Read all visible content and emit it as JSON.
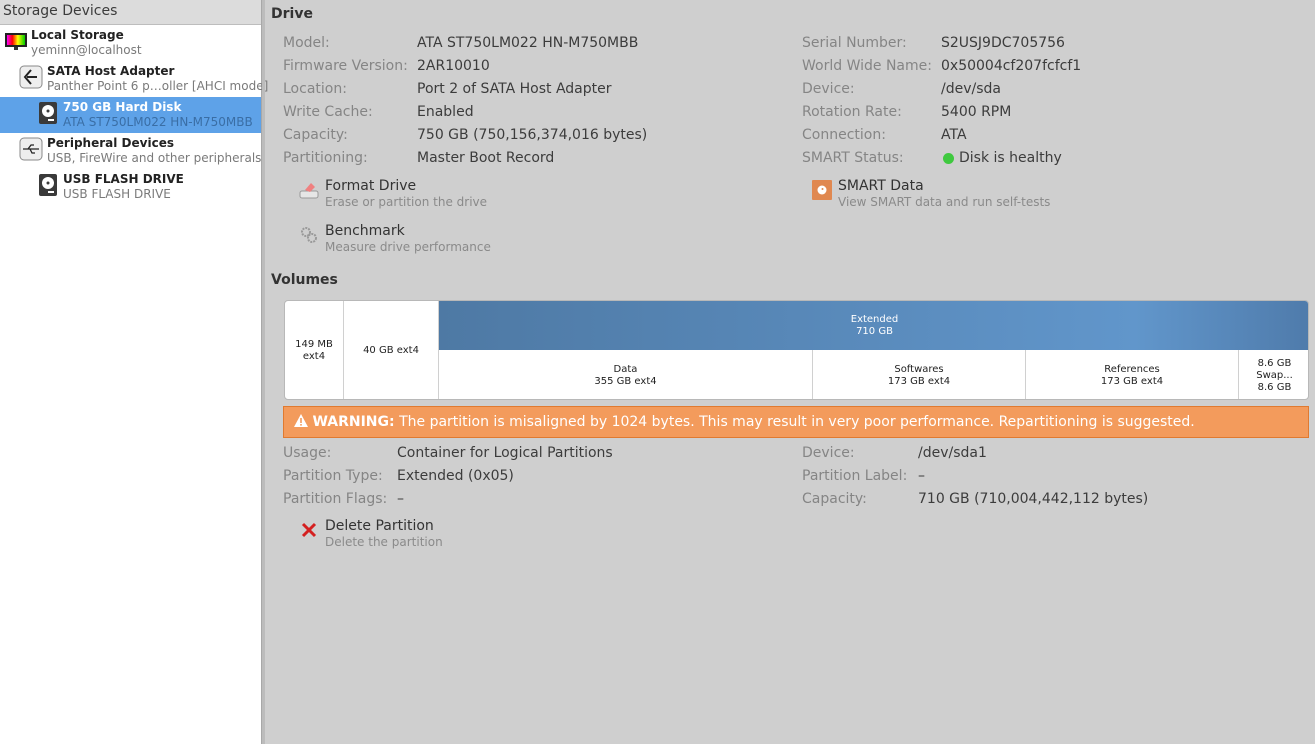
{
  "sidebar": {
    "title": "Storage Devices",
    "items": [
      {
        "title": "Local Storage",
        "subtitle": "yeminn@localhost"
      },
      {
        "title": "SATA Host Adapter",
        "subtitle": "Panther Point 6 p…oller [AHCI mode]"
      },
      {
        "title": "750 GB Hard Disk",
        "subtitle": "ATA ST750LM022 HN-M750MBB"
      },
      {
        "title": "Peripheral Devices",
        "subtitle": "USB, FireWire and other peripherals"
      },
      {
        "title": "USB FLASH DRIVE",
        "subtitle": "USB FLASH DRIVE"
      }
    ]
  },
  "drive": {
    "heading": "Drive",
    "left": [
      {
        "k": "Model:",
        "v": "ATA ST750LM022 HN-M750MBB"
      },
      {
        "k": "Firmware Version:",
        "v": "2AR10010"
      },
      {
        "k": "Location:",
        "v": "Port 2 of SATA Host Adapter"
      },
      {
        "k": "Write Cache:",
        "v": "Enabled"
      },
      {
        "k": "Capacity:",
        "v": "750 GB (750,156,374,016 bytes)"
      },
      {
        "k": "Partitioning:",
        "v": "Master Boot Record"
      }
    ],
    "right": [
      {
        "k": "Serial Number:",
        "v": "S2USJ9DC705756"
      },
      {
        "k": "World Wide Name:",
        "v": "0x50004cf207fcfcf1"
      },
      {
        "k": "Device:",
        "v": "/dev/sda"
      },
      {
        "k": "Rotation Rate:",
        "v": "5400 RPM"
      },
      {
        "k": "Connection:",
        "v": "ATA"
      },
      {
        "k": "SMART Status:",
        "v": "Disk is healthy"
      }
    ],
    "actions": {
      "format": {
        "title": "Format Drive",
        "sub": "Erase or partition the drive"
      },
      "benchmark": {
        "title": "Benchmark",
        "sub": "Measure drive performance"
      },
      "smart": {
        "title": "SMART Data",
        "sub": "View SMART data and run self-tests"
      }
    }
  },
  "volumes": {
    "heading": "Volumes",
    "p1": "149 MB ext4",
    "p2": "40 GB ext4",
    "ext_name": "Extended",
    "ext_size": "710 GB",
    "logical": [
      {
        "name": "Data",
        "size": "355 GB ext4"
      },
      {
        "name": "Softwares",
        "size": "173 GB ext4"
      },
      {
        "name": "References",
        "size": "173 GB ext4"
      },
      {
        "name": "8.6 GB Swap...",
        "size": "8.6 GB"
      }
    ],
    "warning_label": "WARNING:",
    "warning_text": "The partition is misaligned by 1024 bytes. This may result in very poor performance. Repartitioning is suggested.",
    "left": [
      {
        "k": "Usage:",
        "v": "Container for Logical Partitions"
      },
      {
        "k": "Partition Type:",
        "v": "Extended (0x05)"
      },
      {
        "k": "Partition Flags:",
        "v": "–"
      }
    ],
    "right": [
      {
        "k": "Device:",
        "v": "/dev/sda1"
      },
      {
        "k": "Partition Label:",
        "v": "–"
      },
      {
        "k": "Capacity:",
        "v": "710 GB (710,004,442,112 bytes)"
      }
    ],
    "delete": {
      "title": "Delete Partition",
      "sub": "Delete the partition"
    }
  },
  "colors": {
    "selection": "#5ea2e8",
    "warning": "#f39b5c",
    "healthy": "#3fc93f"
  }
}
